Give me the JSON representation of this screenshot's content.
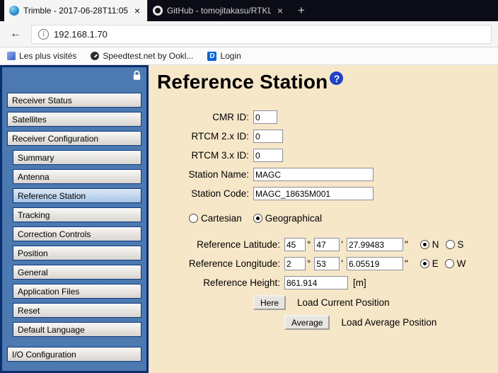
{
  "browser": {
    "tabs": [
      {
        "title": "Trimble - 2017-06-28T11:05:",
        "close": "×"
      },
      {
        "title": "GitHub - tomojitakasu/RTKL",
        "close": "×"
      }
    ],
    "new_tab": "+",
    "back": "←",
    "info": "i",
    "url": "192.168.1.70",
    "bookmarks": [
      {
        "label": "Les plus visités"
      },
      {
        "label": "Speedtest.net by Ookl..."
      },
      {
        "label": "Login",
        "icon_letter": "D"
      }
    ]
  },
  "sidebar": {
    "items": [
      {
        "label": "Receiver Status"
      },
      {
        "label": "Satellites"
      },
      {
        "label": "Receiver Configuration"
      },
      {
        "label": "Summary"
      },
      {
        "label": "Antenna"
      },
      {
        "label": "Reference Station",
        "selected": true
      },
      {
        "label": "Tracking"
      },
      {
        "label": "Correction Controls"
      },
      {
        "label": "Position"
      },
      {
        "label": "General"
      },
      {
        "label": "Application Files"
      },
      {
        "label": "Reset"
      },
      {
        "label": "Default Language"
      },
      {
        "label": "I/O Configuration"
      }
    ]
  },
  "main": {
    "title": "Reference Station",
    "help": "?",
    "fields": {
      "cmr": {
        "label": "CMR ID:",
        "value": "0"
      },
      "rtcm2": {
        "label": "RTCM 2.x ID:",
        "value": "0"
      },
      "rtcm3": {
        "label": "RTCM 3.x ID:",
        "value": "0"
      },
      "station_name": {
        "label": "Station Name:",
        "value": "MAGC"
      },
      "station_code": {
        "label": "Station Code:",
        "value": "MAGC_18635M001"
      }
    },
    "coord_type": {
      "cartesian": "Cartesian",
      "geographical": "Geographical",
      "selected": "Geographical"
    },
    "symbols": {
      "deg": "°",
      "min": "'",
      "sec": "\""
    },
    "latitude": {
      "label": "Reference Latitude:",
      "deg": "45",
      "min": "47",
      "sec": "27.99483",
      "north": "N",
      "south": "S",
      "selected": "N"
    },
    "longitude": {
      "label": "Reference Longitude:",
      "deg": "2",
      "min": "53",
      "sec": "6.05519",
      "east": "E",
      "west": "W",
      "selected": "E"
    },
    "height": {
      "label": "Reference Height:",
      "value": "861.914",
      "unit": "[m]"
    },
    "actions": {
      "here": "Here",
      "here_text": "Load Current Position",
      "average": "Average",
      "average_text": "Load Average Position"
    },
    "colors": {
      "sidebar_blue": "#4b79b0",
      "sidebar_border": "#0a2d6e",
      "page_beige": "#f7e7c9",
      "help_blue": "#2041c8"
    }
  }
}
